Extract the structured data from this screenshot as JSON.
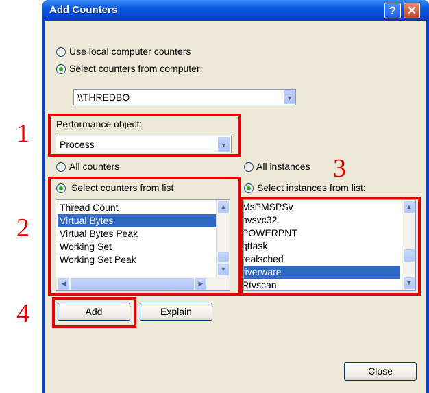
{
  "window": {
    "title": "Add Counters",
    "help_glyph": "?",
    "close_glyph": "✕"
  },
  "source": {
    "local_label": "Use local computer counters",
    "remote_label": "Select counters from computer:",
    "selected": "remote",
    "computer_value": "\\\\THREDBO"
  },
  "performance_object": {
    "label": "Performance object:",
    "value": "Process"
  },
  "counters": {
    "all_label": "All counters",
    "list_label": "Select counters from list",
    "selected_mode": "list",
    "items": [
      "Thread Count",
      "Virtual Bytes",
      "Virtual Bytes Peak",
      "Working Set",
      "Working Set Peak"
    ],
    "selected_item": "Virtual Bytes"
  },
  "instances": {
    "all_label": "All instances",
    "list_label": "Select instances from list:",
    "selected_mode": "list",
    "items": [
      "MsPMSPSv",
      "nvsvc32",
      "POWERPNT",
      "qttask",
      "realsched",
      "riverware",
      "Rtvscan"
    ],
    "selected_item": "riverware"
  },
  "buttons": {
    "add": "Add",
    "explain": "Explain",
    "close": "Close"
  },
  "annotations": {
    "one": "1",
    "two": "2",
    "three": "3",
    "four": "4"
  },
  "colors": {
    "annotation": "#e30000",
    "selection": "#316ac5",
    "title_bar": "#0a5ae0",
    "dialog_bg": "#ece9d8"
  }
}
